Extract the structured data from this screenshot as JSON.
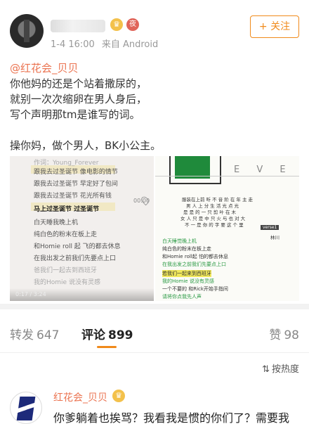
{
  "header": {
    "crown_badge": "♛",
    "night_badge": "夜",
    "timestamp": "1-4 16:00",
    "source": "来自 Android",
    "follow_label": "+ 关注"
  },
  "post": {
    "mention": "@红花会_贝贝",
    "lines": [
      "你他妈的还是个站着撒尿的，",
      "就别一次次缩卵在男人身后，",
      "写个声明那tm是谁写的词。"
    ],
    "last_line": "操你妈，做个男人，BK小公主。"
  },
  "images": {
    "left": {
      "lyrics": [
        "作词：Young_Forever",
        "跟我去过圣诞节 像电影的情节",
        "跟我去过圣诞节 早定好了包间",
        "跟我去过圣诞节 花光所有钱",
        "马上过圣诞节 过圣诞节",
        "白天睡我晚上机",
        "纯白色的粉末在板上走",
        "和Homie roll 起 飞的都去休息",
        "在我出发之前我们先要点上口",
        "爸我们一起去到西班牙",
        "我的Homie 说没有灵感"
      ],
      "time": "00:00",
      "player_time": "0:17 / 3:24"
    },
    "right": {
      "title": "E V E",
      "tag": "verse1",
      "tag2": "林川",
      "lines_top": [
        "服装在上前 听 不 音 阶 在 年 主 走",
        "男 人 上 分 生 活 光 点 光",
        "是 是 的 一 只 剪 叶 在 木",
        "女 人 只 是 中 只 火 与 也 对 大",
        "不 一 是 你 的 字 要 这 个 里"
      ],
      "lines_bottom": [
        "白天睡觉晚上机",
        "纯白色的粉末在板上走",
        "和Homie roll起 怕的都去休息",
        "在我出发之前我们先要点上口",
        "若我们一起来到西班牙",
        "我的Homie 说没有灵感",
        "一个不要的 和Rick开始手指间",
        "请将你点我先人声"
      ]
    }
  },
  "tabs": {
    "forward_label": "转发",
    "forward_count": "647",
    "comment_label": "评论",
    "comment_count": "899",
    "like_label": "赞",
    "like_count": "98"
  },
  "sort": {
    "icon": "⇅",
    "label": "按热度"
  },
  "comment": {
    "name": "红花会_贝贝",
    "crown_badge": "♛",
    "text": "你爹躺着也挨骂？我看我是惯的你们了？需要我"
  },
  "colors": {
    "accent": "#f08a1b",
    "link": "#eb7350"
  }
}
